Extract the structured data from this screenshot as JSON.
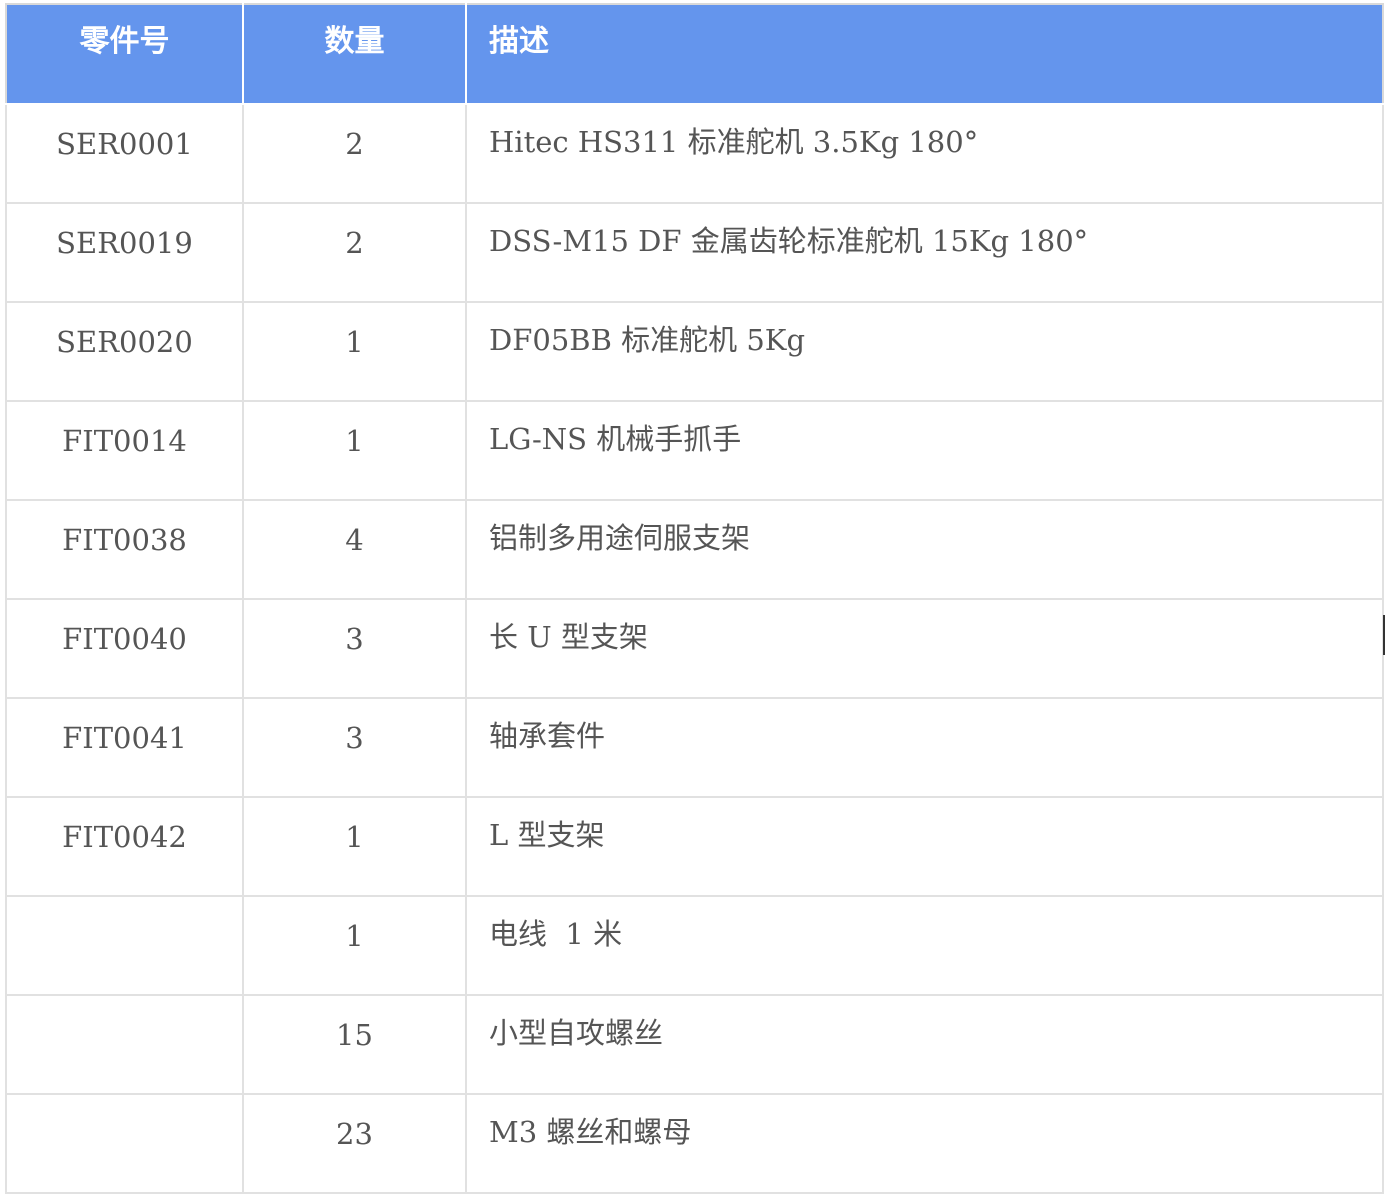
{
  "table": {
    "headers": {
      "part_no": "零件号",
      "quantity": "数量",
      "description": "描述"
    },
    "rows": [
      {
        "part_no": "SER0001",
        "quantity": "2",
        "description": "Hitec HS311 标准舵机 3.5Kg 180°"
      },
      {
        "part_no": "SER0019",
        "quantity": "2",
        "description": "DSS-M15 DF 金属齿轮标准舵机 15Kg 180°"
      },
      {
        "part_no": "SER0020",
        "quantity": "1",
        "description": "DF05BB 标准舵机 5Kg"
      },
      {
        "part_no": "FIT0014",
        "quantity": "1",
        "description": "LG-NS 机械手抓手"
      },
      {
        "part_no": "FIT0038",
        "quantity": "4",
        "description": "铝制多用途伺服支架"
      },
      {
        "part_no": "FIT0040",
        "quantity": "3",
        "description": "长 U 型支架"
      },
      {
        "part_no": "FIT0041",
        "quantity": "3",
        "description": "轴承套件"
      },
      {
        "part_no": "FIT0042",
        "quantity": "1",
        "description": "L 型支架"
      },
      {
        "part_no": "",
        "quantity": "1",
        "description": "电线  1 米"
      },
      {
        "part_no": "",
        "quantity": "15",
        "description": "小型自攻螺丝"
      },
      {
        "part_no": "",
        "quantity": "23",
        "description": "M3 螺丝和螺母"
      }
    ]
  },
  "colors": {
    "header_background": "#6495ed",
    "header_text": "#ffffff",
    "cell_text": "#555555",
    "border": "#e1e1e1"
  }
}
